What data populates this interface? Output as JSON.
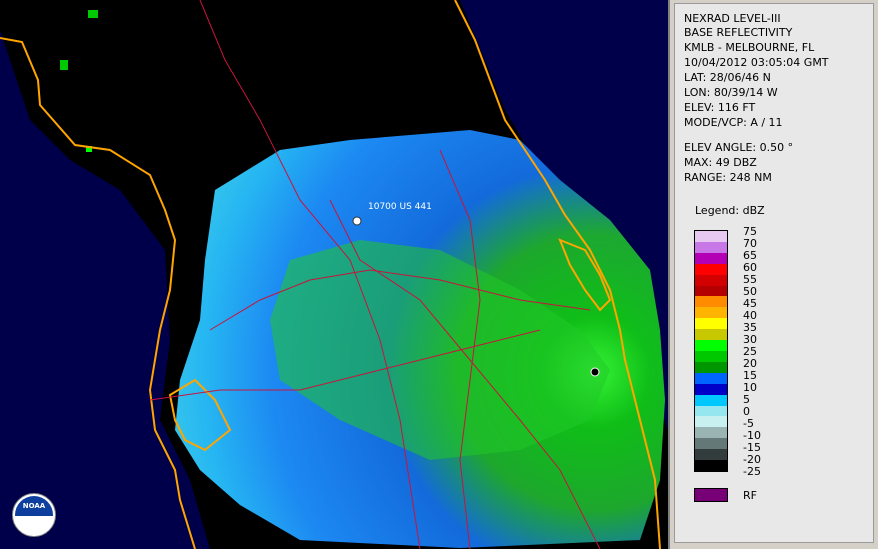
{
  "info": {
    "product": "NEXRAD LEVEL-III",
    "type": "BASE REFLECTIVITY",
    "station": "KMLB - MELBOURNE, FL",
    "datetime": "10/04/2012 03:05:04 GMT",
    "lat": "LAT: 28/06/46 N",
    "lon": "LON: 80/39/14 W",
    "elev": "ELEV: 116 FT",
    "mode": "MODE/VCP: A / 11",
    "elev_angle": "ELEV ANGLE: 0.50 °",
    "max": "MAX: 49 DBZ",
    "range": "RANGE: 248 NM"
  },
  "legend": {
    "title": "Legend: dBZ",
    "labels": [
      "75",
      "70",
      "65",
      "60",
      "55",
      "50",
      "45",
      "40",
      "35",
      "30",
      "25",
      "20",
      "15",
      "10",
      "5",
      "0",
      "-5",
      "-10",
      "-15",
      "-20",
      "-25"
    ],
    "colors": [
      "#e6c8f0",
      "#c878e6",
      "#b400b4",
      "#ff0000",
      "#d20000",
      "#b40000",
      "#ff8c00",
      "#ffb400",
      "#ffff00",
      "#c8c800",
      "#00ff00",
      "#00c800",
      "#009600",
      "#0064ff",
      "#0000c8",
      "#00c8ff",
      "#96e6f0",
      "#c8f0f0",
      "#9ab4b4",
      "#647878",
      "#323c3c",
      "#000000"
    ],
    "rf_label": "RF",
    "rf_color": "#770077"
  },
  "map": {
    "site_label": "10700 US 441",
    "logo_text": "NOAA",
    "background": "#00004a",
    "land": "#000000",
    "state_line_color": "#ffa500",
    "road_color": "#c8143c"
  }
}
